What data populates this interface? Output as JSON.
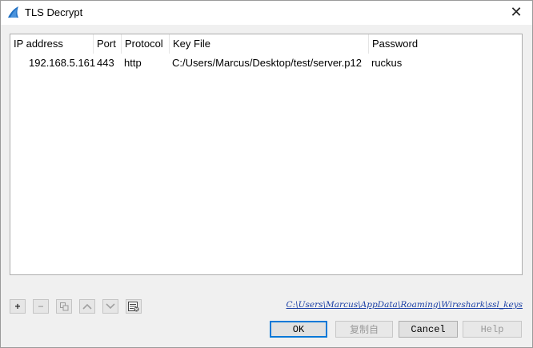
{
  "window": {
    "title": "TLS Decrypt",
    "close_glyph": "✕",
    "app_icon": "wireshark-fin-icon",
    "accent_color": "#0078d7"
  },
  "table": {
    "columns": [
      "IP address",
      "Port",
      "Protocol",
      "Key File",
      "Password"
    ],
    "rows": [
      {
        "ip": "192.168.5.161",
        "port": "443",
        "protocol": "http",
        "key_file": "C:/Users/Marcus/Desktop/test/server.p12",
        "password": "ruckus"
      }
    ]
  },
  "toolbar": {
    "add": "+",
    "remove": "−",
    "copy_icon": "copy-icon",
    "move_up_icon": "chevron-up-icon",
    "move_down_icon": "chevron-down-icon",
    "clear_icon": "clear-table-icon"
  },
  "path_link": "C:\\Users\\Marcus\\AppData\\Roaming\\Wireshark\\ssl_keys",
  "buttons": {
    "ok": "OK",
    "copy_from": "复制自",
    "cancel": "Cancel",
    "help": "Help"
  }
}
